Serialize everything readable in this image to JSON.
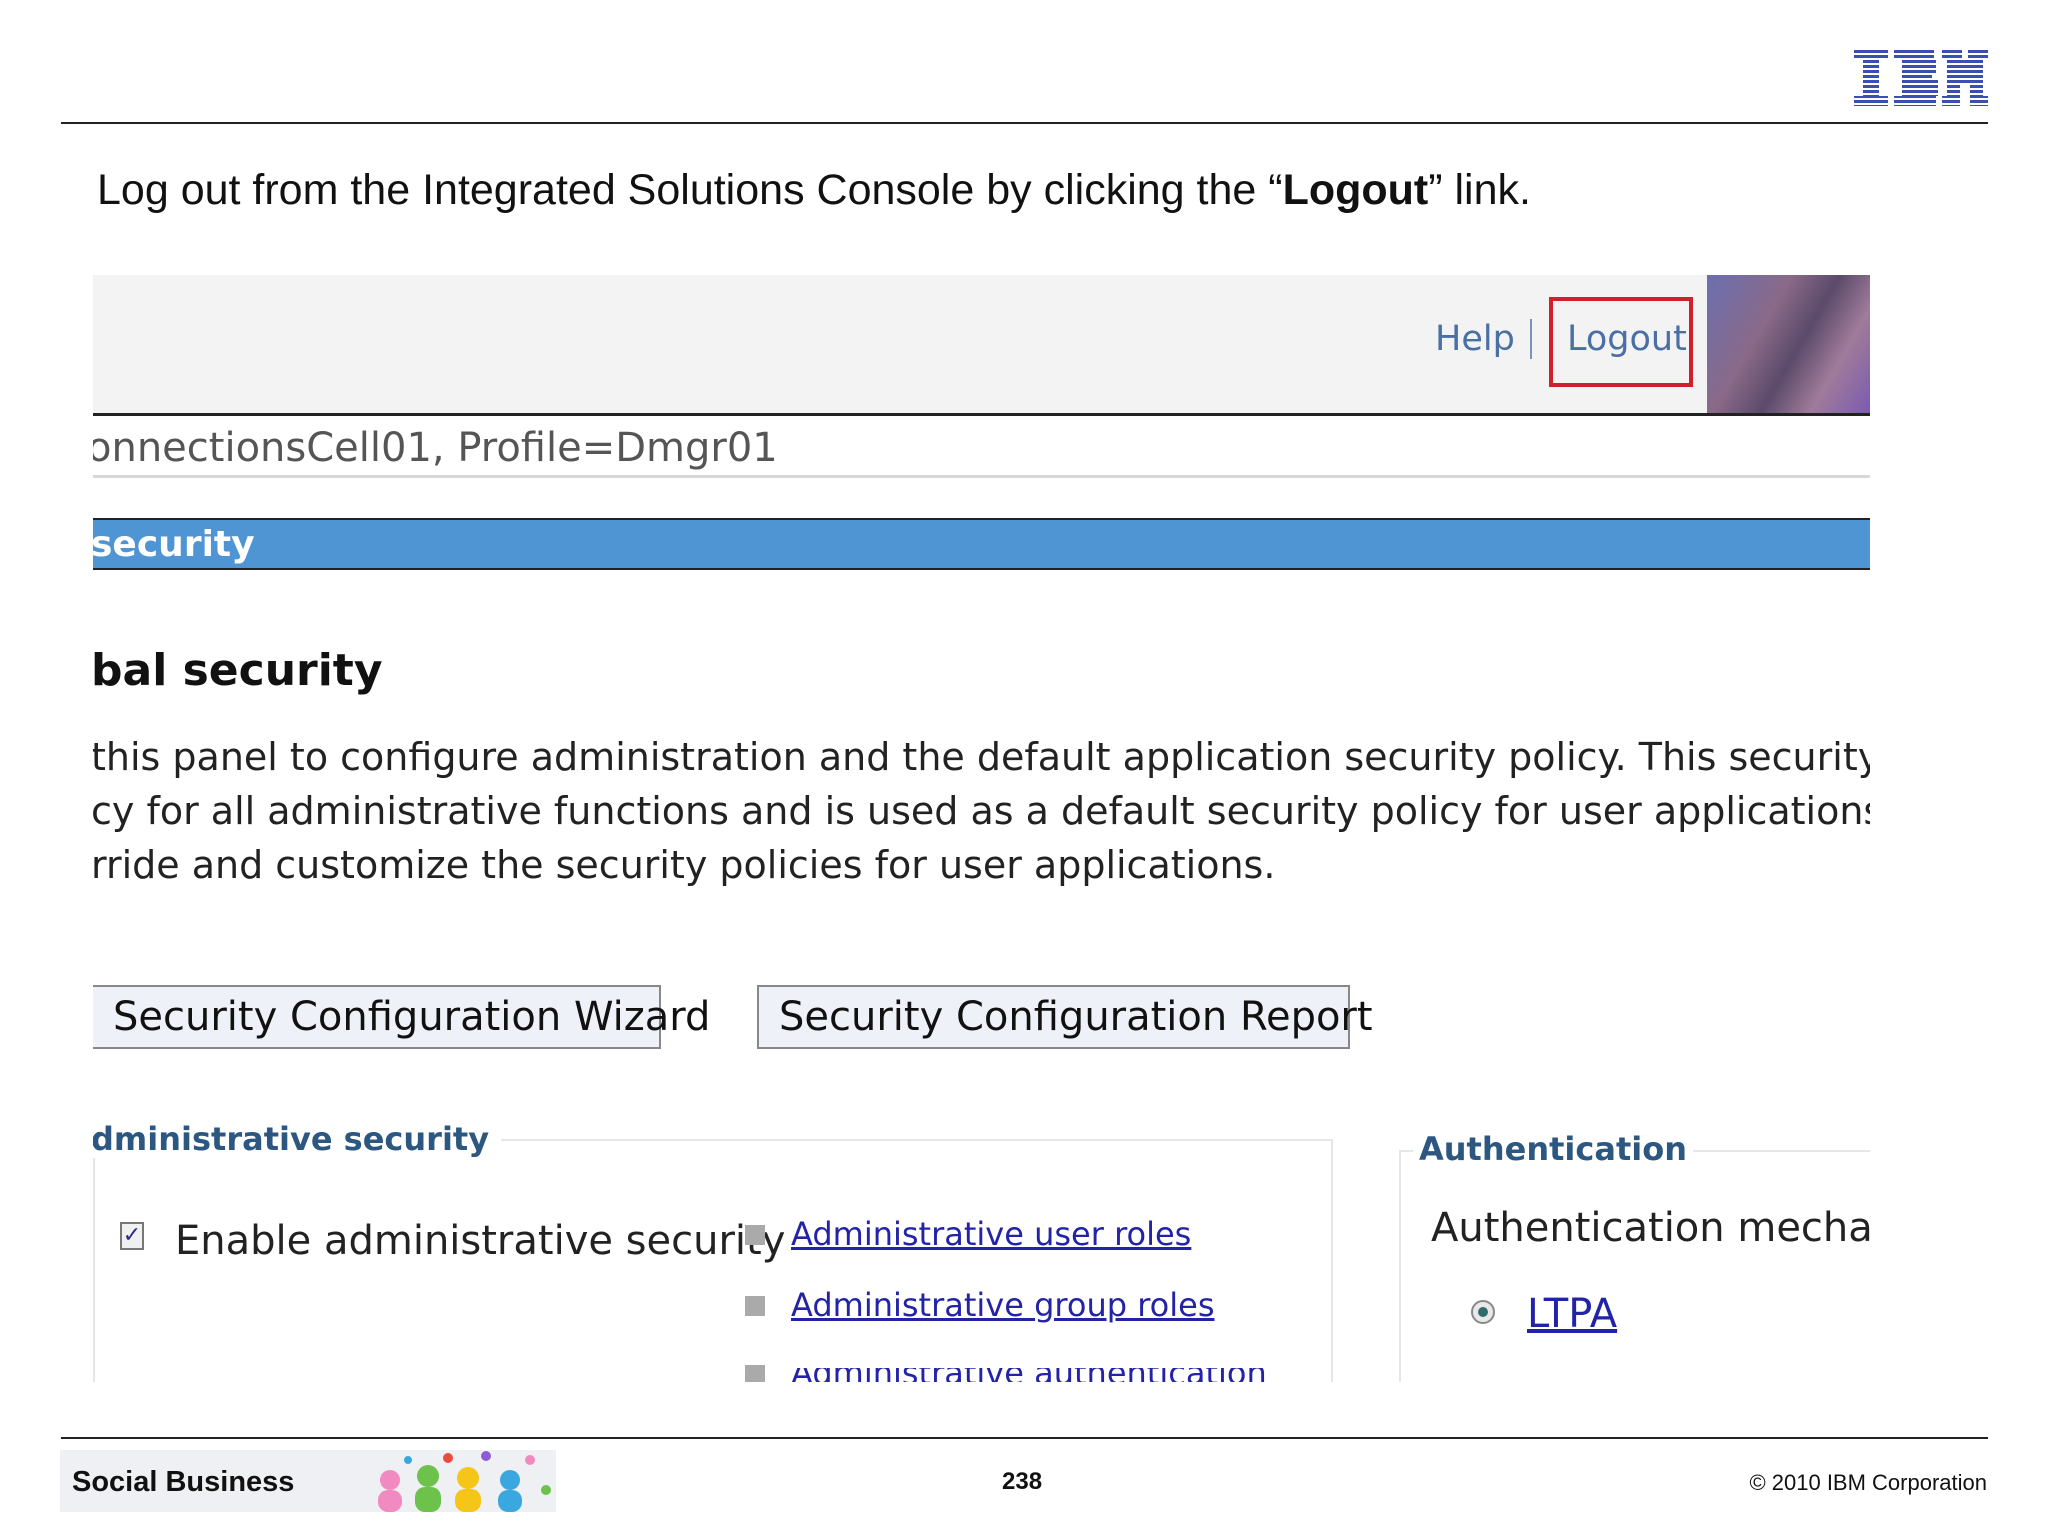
{
  "slide": {
    "instruction_prefix": "Log out from the Integrated Solutions Console by clicking the “",
    "instruction_bold": "Logout",
    "instruction_suffix": "” link.",
    "brand_logo": "IBM",
    "footer_brand": "Social Business",
    "page_number": "238",
    "copyright": "© 2010 IBM Corporation"
  },
  "console": {
    "header_links": {
      "help": "Help",
      "logout": "Logout"
    },
    "cell_profile": "onnectionsCell01, Profile=Dmgr01",
    "title_bar": "security",
    "page_heading": "bal security",
    "description": [
      " this panel to configure administration and the default application security policy. This security configurati",
      "cy for all administrative functions and is used as a default security policy for user applications. Security de",
      "rride and customize the security policies for user applications."
    ],
    "buttons": {
      "wizard": "Security Configuration Wizard",
      "report": "Security Configuration Report"
    },
    "admin_security": {
      "legend": "dministrative security",
      "checkbox_label": "Enable administrative security",
      "checkbox_checked": true,
      "links": [
        "Administrative user roles",
        "Administrative group roles",
        "Administrative authentication"
      ]
    },
    "authentication": {
      "legend": "Authentication",
      "mechanism_label": "Authentication mechanism",
      "selected_option": "LTPA"
    }
  },
  "colors": {
    "title_bar": "#4f95d4",
    "logout_highlight": "#d0202a",
    "link": "#2323a8",
    "legend": "#2c5780"
  }
}
